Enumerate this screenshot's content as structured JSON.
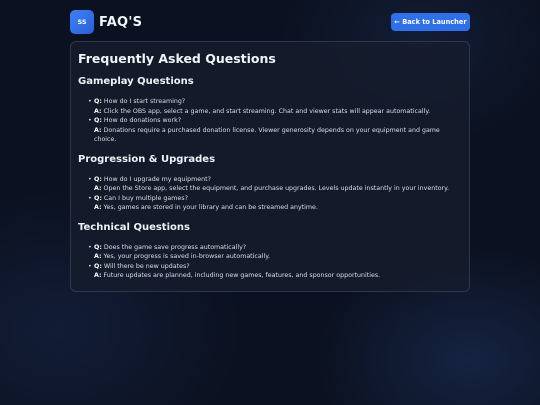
{
  "header": {
    "logo_text": "SS",
    "title": "FAQ'S",
    "back_button_label": "← Back to Launcher"
  },
  "faq": {
    "heading": "Frequently Asked Questions",
    "q_prefix": "Q:",
    "a_prefix": "A:",
    "sections": [
      {
        "title": "Gameplay Questions",
        "items": [
          {
            "q": "How do I start streaming?",
            "a": "Click the OBS app, select a game, and start streaming. Chat and viewer stats will appear automatically."
          },
          {
            "q": "How do donations work?",
            "a": "Donations require a purchased donation license. Viewer generosity depends on your equipment and game choice."
          }
        ]
      },
      {
        "title": "Progression & Upgrades",
        "items": [
          {
            "q": "How do I upgrade my equipment?",
            "a": "Open the Store app, select the equipment, and purchase upgrades. Levels update instantly in your inventory."
          },
          {
            "q": "Can I buy multiple games?",
            "a": "Yes, games are stored in your library and can be streamed anytime."
          }
        ]
      },
      {
        "title": "Technical Questions",
        "items": [
          {
            "q": "Does the game save progress automatically?",
            "a": "Yes, your progress is saved in-browser automatically."
          },
          {
            "q": "Will there be new updates?",
            "a": "Future updates are planned, including new games, features, and sponsor opportunities."
          }
        ]
      }
    ]
  }
}
